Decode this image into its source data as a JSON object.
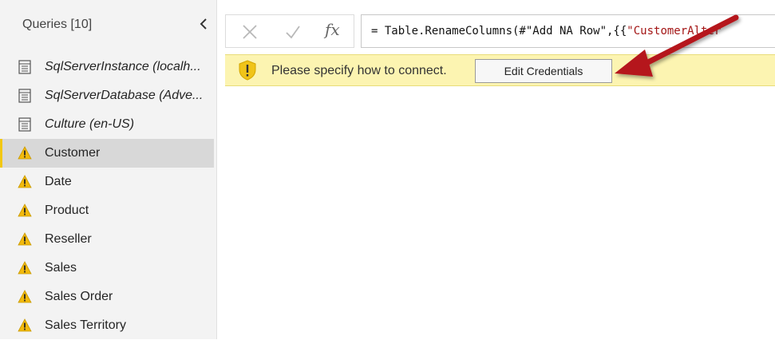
{
  "sidebar": {
    "title": "Queries [10]",
    "items": [
      {
        "label": "SqlServerInstance (localh...",
        "icon": "table-icon",
        "italic": true
      },
      {
        "label": "SqlServerDatabase (Adve...",
        "icon": "table-icon",
        "italic": true
      },
      {
        "label": "Culture (en-US)",
        "icon": "table-icon",
        "italic": true
      },
      {
        "label": "Customer",
        "icon": "warning-icon",
        "selected": true
      },
      {
        "label": "Date",
        "icon": "warning-icon"
      },
      {
        "label": "Product",
        "icon": "warning-icon"
      },
      {
        "label": "Reseller",
        "icon": "warning-icon"
      },
      {
        "label": "Sales",
        "icon": "warning-icon"
      },
      {
        "label": "Sales Order",
        "icon": "warning-icon"
      },
      {
        "label": "Sales Territory",
        "icon": "warning-icon"
      }
    ]
  },
  "formula_bar": {
    "fx_label": "fx",
    "formula_prefix": "= Table.RenameColumns(#\"Add NA Row\",{{",
    "formula_string": "\"CustomerAlter"
  },
  "warning": {
    "message": "Please specify how to connect.",
    "button_label": "Edit Credentials"
  },
  "colors": {
    "accent": "#f2c811",
    "warning_bg": "#fcf4b1",
    "arrow": "#b5191f"
  }
}
